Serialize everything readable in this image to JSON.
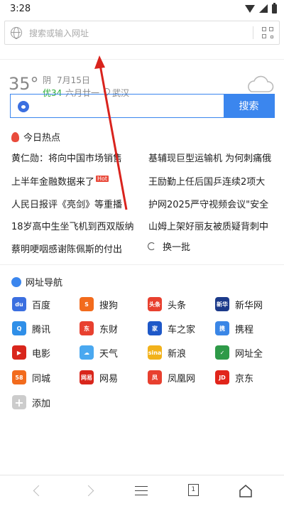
{
  "statusbar": {
    "time": "3:28"
  },
  "urlbar": {
    "placeholder": "搜索或输入网址"
  },
  "weather": {
    "temp": "35°",
    "condition": "阴",
    "date": "7月15日",
    "aqi": "优34",
    "lunar": "六月廿一",
    "city": "武汉"
  },
  "search": {
    "button": "搜索",
    "value": ""
  },
  "hot": {
    "title": "今日热点",
    "badge": "Hot",
    "refresh": "换一批",
    "left": [
      "黄仁勋：将向中国市场销售",
      "上半年金融数据来了",
      "人民日报评《亮剑》等重播",
      "18岁高中生坐飞机到西双版纳",
      "蔡明哽咽感谢陈佩斯的付出"
    ],
    "right": [
      "基辅现巨型运输机 为何刺痛俄",
      "王励勤上任后国乒连续2项大",
      "护网2025严守视频会议\"安全",
      "山姆上架好丽友被质疑背刺中"
    ]
  },
  "nav": {
    "title": "网址导航",
    "sites": [
      {
        "label": "百度",
        "icon": "baidu-icon",
        "color": "#3b6fe0",
        "glyph": "du"
      },
      {
        "label": "搜狗",
        "icon": "sogou-icon",
        "color": "#f26b1d",
        "glyph": "S"
      },
      {
        "label": "头条",
        "icon": "toutiao-icon",
        "color": "#e8402f",
        "glyph": "头条"
      },
      {
        "label": "新华网",
        "icon": "xinhua-icon",
        "color": "#1c3a8a",
        "glyph": "新华"
      },
      {
        "label": "腾讯",
        "icon": "tencent-icon",
        "color": "#2f8fe8",
        "glyph": "Q"
      },
      {
        "label": "东财",
        "icon": "dongcai-icon",
        "color": "#e8402f",
        "glyph": "东"
      },
      {
        "label": "车之家",
        "icon": "autohome-icon",
        "color": "#1e58c8",
        "glyph": "家"
      },
      {
        "label": "携程",
        "icon": "ctrip-icon",
        "color": "#3a86e6",
        "glyph": "携"
      },
      {
        "label": "电影",
        "icon": "movie-icon",
        "color": "#d9261c",
        "glyph": "▶"
      },
      {
        "label": "天气",
        "icon": "weather-icon",
        "color": "#4aa8f0",
        "glyph": "☁"
      },
      {
        "label": "新浪",
        "icon": "sina-icon",
        "color": "#f2b21b",
        "glyph": "sina"
      },
      {
        "label": "网址全",
        "icon": "url-all-icon",
        "color": "#2e9a48",
        "glyph": "✓"
      },
      {
        "label": "同城",
        "icon": "58-icon",
        "color": "#f26b1d",
        "glyph": "58"
      },
      {
        "label": "网易",
        "icon": "netease-icon",
        "color": "#d9261c",
        "glyph": "网易"
      },
      {
        "label": "凤凰网",
        "icon": "ifeng-icon",
        "color": "#e8402f",
        "glyph": "凤"
      },
      {
        "label": "京东",
        "icon": "jd-icon",
        "color": "#e1251b",
        "glyph": "JD"
      },
      {
        "label": "添加",
        "icon": "add-icon",
        "color": "#cccccc",
        "glyph": "+"
      }
    ]
  },
  "bottombar": {
    "tab_count": "1"
  },
  "colors": {
    "accent": "#3b86ee",
    "annotation_arrow": "#d9231d",
    "hot": "#e94b3c",
    "aqi": "#2bab37"
  }
}
